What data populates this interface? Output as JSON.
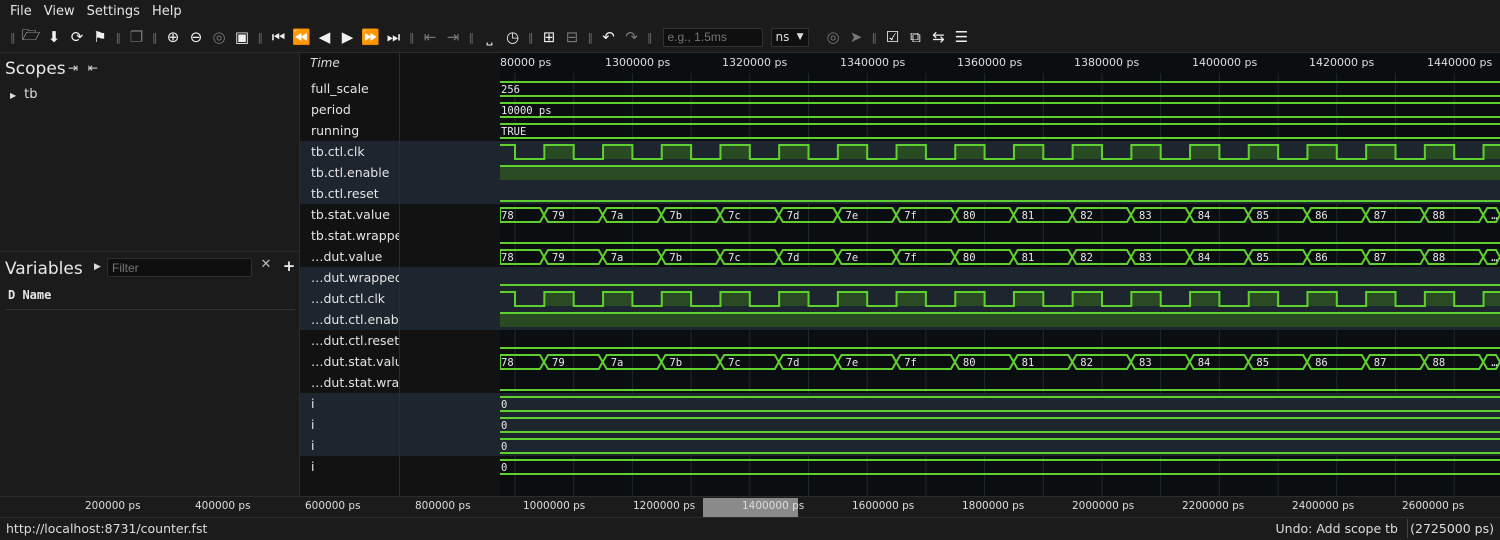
{
  "menu": [
    "File",
    "View",
    "Settings",
    "Help"
  ],
  "toolbar": {
    "time_input_placeholder": "e.g., 1.5ms",
    "time_unit": "ns"
  },
  "scopes": {
    "title": "Scopes",
    "items": [
      {
        "label": "tb"
      }
    ]
  },
  "variables": {
    "title": "Variables",
    "filter_placeholder": "Filter",
    "header": "D Name"
  },
  "waves": {
    "time_header": "Time",
    "axis_ticks": [
      "80000 ps",
      "1300000 ps",
      "1320000 ps",
      "1340000 ps",
      "1360000 ps",
      "1380000 ps",
      "1400000 ps",
      "1420000 ps",
      "1440000 ps"
    ],
    "signals": [
      {
        "name": "full_scale",
        "kind": "const",
        "value": "256",
        "hl": false
      },
      {
        "name": "period",
        "kind": "const",
        "value": "10000 ps",
        "hl": false
      },
      {
        "name": "running",
        "kind": "const",
        "value": "TRUE",
        "hl": false
      },
      {
        "name": "tb.ctl.clk",
        "kind": "clock",
        "hl": true
      },
      {
        "name": "tb.ctl.enable",
        "kind": "high",
        "hl": true
      },
      {
        "name": "tb.ctl.reset",
        "kind": "low",
        "hl": true
      },
      {
        "name": "tb.stat.value",
        "kind": "bus",
        "hl": false
      },
      {
        "name": "tb.stat.wrapped",
        "kind": "low",
        "hl": false
      },
      {
        "name": "…dut.value",
        "kind": "bus",
        "hl": false
      },
      {
        "name": "…dut.wrapped",
        "kind": "low",
        "hl": true
      },
      {
        "name": "…dut.ctl.clk",
        "kind": "clock",
        "hl": true
      },
      {
        "name": "…dut.ctl.enable",
        "kind": "high",
        "hl": true
      },
      {
        "name": "…dut.ctl.reset",
        "kind": "low",
        "hl": false
      },
      {
        "name": "…dut.stat.value",
        "kind": "bus",
        "hl": false
      },
      {
        "name": "…dut.stat.wrapped",
        "kind": "low",
        "hl": false
      },
      {
        "name": "i",
        "kind": "const",
        "value": "0",
        "hl": true
      },
      {
        "name": "i",
        "kind": "const",
        "value": "0",
        "hl": true
      },
      {
        "name": "i",
        "kind": "const",
        "value": "0",
        "hl": true
      },
      {
        "name": "i",
        "kind": "const",
        "value": "0",
        "hl": false
      }
    ],
    "bus_values": [
      "78",
      "79",
      "7a",
      "7b",
      "7c",
      "7d",
      "7e",
      "7f",
      "80",
      "81",
      "82",
      "83",
      "84",
      "85",
      "86",
      "87",
      "88",
      "…"
    ]
  },
  "overview_ticks": [
    "200000 ps",
    "400000 ps",
    "600000 ps",
    "800000 ps",
    "1000000 ps",
    "1200000 ps",
    "1400000 ps",
    "1600000 ps",
    "1800000 ps",
    "2000000 ps",
    "2200000 ps",
    "2400000 ps",
    "2600000 ps"
  ],
  "status": {
    "url": "http://localhost:8731/counter.fst",
    "undo": "Undo: Add scope tb",
    "total": "(2725000 ps)"
  },
  "colors": {
    "signal": "#5fd12e",
    "highlight_row": "#1d262e",
    "fill": "#2a4a24"
  }
}
